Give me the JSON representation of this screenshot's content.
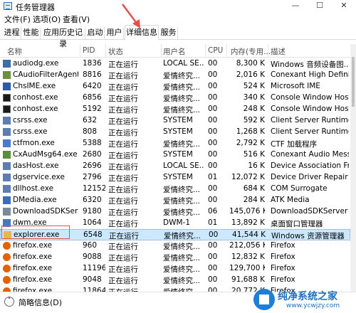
{
  "window": {
    "title": "任务管理器",
    "controls": [
      "—",
      "☐",
      "✕"
    ]
  },
  "menu": [
    "文件(F)",
    "选项(O)",
    "查看(V)"
  ],
  "tabs": [
    {
      "label": "进程",
      "active": false
    },
    {
      "label": "性能",
      "active": false
    },
    {
      "label": "应用历史记录",
      "active": false
    },
    {
      "label": "启动",
      "active": false
    },
    {
      "label": "用户",
      "active": false
    },
    {
      "label": "详细信息",
      "active": true
    },
    {
      "label": "服务",
      "active": false
    }
  ],
  "columns": {
    "name": "名称",
    "pid": "PID",
    "status": "状态",
    "user": "用户名",
    "cpu": "CPU",
    "mem": "内存(专用...",
    "desc": "描述",
    "sort_arrow": "^"
  },
  "rows": [
    {
      "name": "audiodg.exe",
      "pid": "1836",
      "status": "正在运行",
      "user": "LOCAL SE...",
      "cpu": "00",
      "mem": "8,300 K",
      "desc": "Windows 音频设备图...",
      "icon": "audio-process-icon"
    },
    {
      "name": "CAudioFilterAgent...",
      "pid": "8816",
      "status": "正在运行",
      "user": "爱情终究...",
      "cpu": "00",
      "mem": "2,016 K",
      "desc": "Conexant High Definit...",
      "icon": "audio-filter-icon"
    },
    {
      "name": "ChsIME.exe",
      "pid": "6420",
      "status": "正在运行",
      "user": "爱情终究...",
      "cpu": "00",
      "mem": "524 K",
      "desc": "Microsoft IME",
      "icon": "ime-icon"
    },
    {
      "name": "conhost.exe",
      "pid": "6856",
      "status": "正在运行",
      "user": "爱情终究...",
      "cpu": "00",
      "mem": "340 K",
      "desc": "Console Window Host",
      "icon": "console-icon"
    },
    {
      "name": "conhost.exe",
      "pid": "5192",
      "status": "正在运行",
      "user": "爱情终究...",
      "cpu": "00",
      "mem": "248 K",
      "desc": "Console Window Host",
      "icon": "console-icon"
    },
    {
      "name": "csrss.exe",
      "pid": "632",
      "status": "正在运行",
      "user": "SYSTEM",
      "cpu": "00",
      "mem": "592 K",
      "desc": "Client Server Runtime ...",
      "icon": "system-process-icon"
    },
    {
      "name": "csrss.exe",
      "pid": "808",
      "status": "正在运行",
      "user": "SYSTEM",
      "cpu": "00",
      "mem": "1,268 K",
      "desc": "Client Server Runtime ...",
      "icon": "system-process-icon"
    },
    {
      "name": "ctfmon.exe",
      "pid": "5388",
      "status": "正在运行",
      "user": "爱情终究...",
      "cpu": "00",
      "mem": "2,792 K",
      "desc": "CTF 加载程序",
      "icon": "ctf-icon"
    },
    {
      "name": "CxAudMsg64.exe",
      "pid": "2680",
      "status": "正在运行",
      "user": "SYSTEM",
      "cpu": "00",
      "mem": "516 K",
      "desc": "Conexant Audio Mess...",
      "icon": "audio-message-icon"
    },
    {
      "name": "dasHost.exe",
      "pid": "2696",
      "status": "正在运行",
      "user": "LOCAL SE...",
      "cpu": "00",
      "mem": "16 K",
      "desc": "Device Association Fr...",
      "icon": "system-process-icon"
    },
    {
      "name": "dgservice.exe",
      "pid": "2796",
      "status": "正在运行",
      "user": "SYSTEM",
      "cpu": "01",
      "mem": "12,072 K",
      "desc": "Device Driver Repair ...",
      "icon": "system-process-icon"
    },
    {
      "name": "dllhost.exe",
      "pid": "12152",
      "status": "正在运行",
      "user": "爱情终究...",
      "cpu": "00",
      "mem": "684 K",
      "desc": "COM Surrogate",
      "icon": "system-process-icon"
    },
    {
      "name": "DMedia.exe",
      "pid": "6320",
      "status": "正在运行",
      "user": "爱情终究...",
      "cpu": "00",
      "mem": "284 K",
      "desc": "ATK Media",
      "icon": "media-icon"
    },
    {
      "name": "DownloadSDKServ...",
      "pid": "9180",
      "status": "正在运行",
      "user": "爱情终究...",
      "cpu": "06",
      "mem": "145,076 K",
      "desc": "DownloadSDKServer",
      "icon": "download-icon"
    },
    {
      "name": "dwm.exe",
      "pid": "1064",
      "status": "正在运行",
      "user": "DWM-1",
      "cpu": "01",
      "mem": "13,892 K",
      "desc": "桌面窗口管理器",
      "icon": "dwm-icon"
    },
    {
      "name": "explorer.exe",
      "pid": "6548",
      "status": "正在运行",
      "user": "爱情终究...",
      "cpu": "00",
      "mem": "41,544 K",
      "desc": "Windows 资源管理器",
      "icon": "folder-icon",
      "selected": true
    },
    {
      "name": "firefox.exe",
      "pid": "960",
      "status": "正在运行",
      "user": "爱情终究...",
      "cpu": "00",
      "mem": "212,056 K",
      "desc": "Firefox",
      "icon": "firefox-icon"
    },
    {
      "name": "firefox.exe",
      "pid": "9088",
      "status": "正在运行",
      "user": "爱情终究...",
      "cpu": "00",
      "mem": "12,832 K",
      "desc": "Firefox",
      "icon": "firefox-icon"
    },
    {
      "name": "firefox.exe",
      "pid": "11196",
      "status": "正在运行",
      "user": "爱情终究...",
      "cpu": "00",
      "mem": "129,700 K",
      "desc": "Firefox",
      "icon": "firefox-icon"
    },
    {
      "name": "firefox.exe",
      "pid": "9048",
      "status": "正在运行",
      "user": "爱情终究...",
      "cpu": "00",
      "mem": "91,688 K",
      "desc": "Firefox",
      "icon": "firefox-icon"
    },
    {
      "name": "firefox.exe",
      "pid": "11864",
      "status": "正在运行",
      "user": "爱情终究...",
      "cpu": "00",
      "mem": "20,772 K",
      "desc": "Firefox",
      "icon": "firefox-icon"
    }
  ],
  "footer": {
    "label": "简略信息(D)"
  },
  "watermark": {
    "text": "纯净系统之家",
    "url": "www.ycwjzy.com"
  },
  "colors": {
    "selection": "#cce8ff",
    "annotation": "#e5504a",
    "firefox": "#e66000",
    "accent": "#1f7ed6"
  }
}
